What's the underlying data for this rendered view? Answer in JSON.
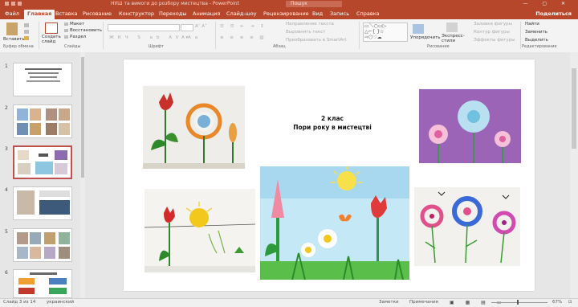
{
  "titlebar": {
    "title": "НУШ та вимоги до розбору мистецтва - PowerPoint",
    "search": "Пошук"
  },
  "tabs": [
    "Файл",
    "Главная",
    "Вставка",
    "Рисование",
    "Конструктор",
    "Переходы",
    "Анимация",
    "Слайд-шоу",
    "Рецензирование",
    "Вид",
    "Запись",
    "Справка"
  ],
  "active_tab": "Главная",
  "share_label": "Поделиться",
  "ribbon": {
    "groups": [
      "Буфер обмена",
      "Слайды",
      "Шрифт",
      "Абзац",
      "Рисование",
      "Редактирование"
    ],
    "paste": "Вставить",
    "new_slide": "Создать слайд",
    "layout": "Макет",
    "reset": "Восстановить",
    "section": "Раздел",
    "text_direction": "Направление текста",
    "align_text": "Выровнять текст",
    "smartart": "Преобразовать в SmartArt",
    "arrange": "Упорядочить",
    "quick_styles": "Экспресс-стили",
    "shape_fill": "Заливка фигуры",
    "shape_outline": "Контур фигуры",
    "shape_effects": "Эффекты фигуры",
    "find": "Найти",
    "replace": "Заменить",
    "select": "Выделить"
  },
  "slides": [
    {
      "num": "1"
    },
    {
      "num": "2"
    },
    {
      "num": "3"
    },
    {
      "num": "4"
    },
    {
      "num": "5"
    },
    {
      "num": "6"
    }
  ],
  "selected_slide": "3",
  "slide": {
    "line1": "2 клас",
    "line2": "Пори року в мистецтві"
  },
  "status": {
    "slide_info": "Слайд 3 из 14",
    "language": "украинский",
    "notes": "Заметки",
    "comments": "Примечания",
    "zoom": "67%"
  },
  "colors": {
    "accent": "#b7472a",
    "selection": "#c0504d"
  }
}
